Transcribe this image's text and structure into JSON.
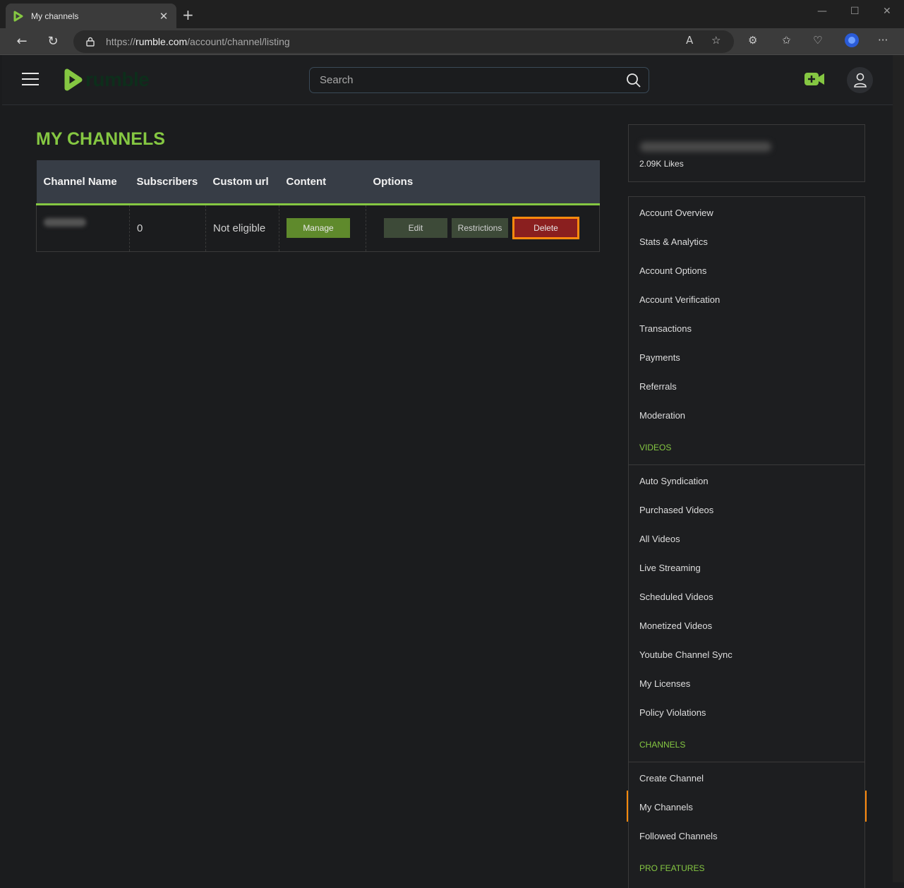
{
  "browser": {
    "tab_title": "My channels",
    "url_scheme": "https://",
    "url_host": "rumble.com",
    "url_path": "/account/channel/listing"
  },
  "header": {
    "logo_text": "rumble",
    "search_placeholder": "Search"
  },
  "page_title": "MY CHANNELS",
  "table": {
    "columns": [
      "Channel Name",
      "Subscribers",
      "Custom url",
      "Content",
      "Options"
    ],
    "rows": [
      {
        "subscribers": "0",
        "custom_url": "Not eligible",
        "manage_label": "Manage",
        "edit_label": "Edit",
        "restrictions_label": "Restrictions",
        "delete_label": "Delete"
      }
    ]
  },
  "profile": {
    "likes": "2.09K Likes"
  },
  "sidebar": {
    "account_items": [
      "Account Overview",
      "Stats & Analytics",
      "Account Options",
      "Account Verification",
      "Transactions",
      "Payments",
      "Referrals",
      "Moderation"
    ],
    "videos_section": "VIDEOS",
    "video_items": [
      "Auto Syndication",
      "Purchased Videos",
      "All Videos",
      "Live Streaming",
      "Scheduled Videos",
      "Monetized Videos",
      "Youtube Channel Sync",
      "My Licenses",
      "Policy Violations"
    ],
    "channels_section": "CHANNELS",
    "channel_items": [
      "Create Channel",
      "My Channels",
      "Followed Channels"
    ],
    "pro_section": "PRO FEATURES"
  },
  "colors": {
    "brand_green": "#85c742",
    "delete_red": "#8a1f1f",
    "highlight_orange": "#ff8a0d"
  }
}
